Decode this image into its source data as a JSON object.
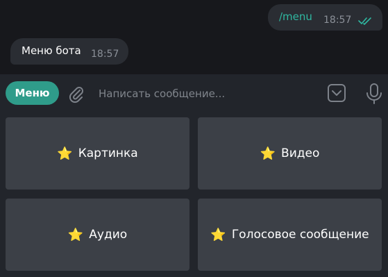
{
  "messages": {
    "outgoing": {
      "text": "/menu",
      "time": "18:57",
      "status_icon": "double-check-icon"
    },
    "incoming": {
      "text": "Меню бота",
      "time": "18:57"
    }
  },
  "composer": {
    "menu_label": "Меню",
    "placeholder": "Написать сообщение...",
    "icons": [
      "paperclip-icon",
      "keyboard-toggle-icon",
      "microphone-icon"
    ]
  },
  "keyboard": {
    "buttons": [
      {
        "emoji": "⭐",
        "label": "Картинка"
      },
      {
        "emoji": "⭐",
        "label": "Видео"
      },
      {
        "emoji": "⭐",
        "label": "Аудио"
      },
      {
        "emoji": "⭐",
        "label": "Голосовое сообщение"
      }
    ]
  },
  "colors": {
    "accent": "#2f9c8a",
    "command_text": "#2fb8a1",
    "bubble": "#2a2d33",
    "key_button": "#3c4047"
  }
}
